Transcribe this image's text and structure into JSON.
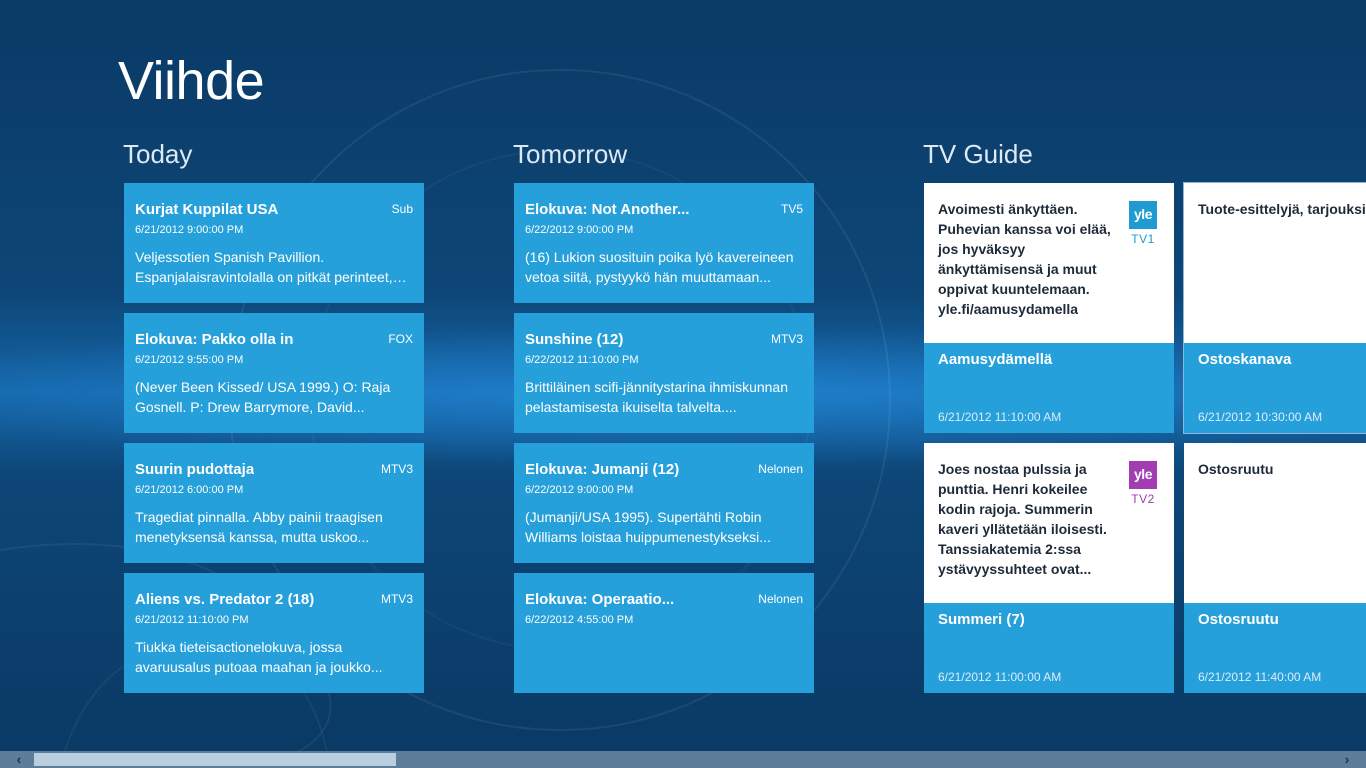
{
  "app": {
    "title": "Viihde"
  },
  "groups": {
    "today": {
      "title": "Today",
      "items": [
        {
          "title": "Kurjat Kuppilat USA",
          "channel": "Sub",
          "date": "6/21/2012 9:00:00 PM",
          "desc": "Veljessotien Spanish Pavillion. Espanjalaisravintolalla on pitkät perinteet, mutta..."
        },
        {
          "title": "Elokuva: Pakko olla in",
          "channel": "FOX",
          "date": "6/21/2012 9:55:00 PM",
          "desc": "(Never Been Kissed/ USA 1999.) O: Raja Gosnell. P: Drew Barrymore, David..."
        },
        {
          "title": "Suurin pudottaja",
          "channel": "MTV3",
          "date": "6/21/2012 6:00:00 PM",
          "desc": "Tragediat pinnalla. Abby painii traagisen menetyksensä kanssa, mutta uskoo..."
        },
        {
          "title": "Aliens vs. Predator 2 (18)",
          "channel": "MTV3",
          "date": "6/21/2012 11:10:00 PM",
          "desc": "Tiukka tieteisactionelokuva, jossa avaruusalus putoaa maahan ja joukko..."
        }
      ]
    },
    "tomorrow": {
      "title": "Tomorrow",
      "items": [
        {
          "title": "Elokuva: Not Another...",
          "channel": "TV5",
          "date": "6/22/2012 9:00:00 PM",
          "desc": "(16) Lukion suosituin poika lyö kavereineen vetoa siitä, pystyykö hän muuttamaan..."
        },
        {
          "title": "Sunshine (12)",
          "channel": "MTV3",
          "date": "6/22/2012 11:10:00 PM",
          "desc": "Brittiläinen scifi-jännitystarina ihmiskunnan pelastamisesta ikuiselta talvelta...."
        },
        {
          "title": "Elokuva: Jumanji (12)",
          "channel": "Nelonen",
          "date": "6/22/2012 9:00:00 PM",
          "desc": "(Jumanji/USA 1995). Supertähti Robin Williams loistaa huippumenestykseksi..."
        },
        {
          "title": "Elokuva: Operaatio...",
          "channel": "Nelonen",
          "date": "6/22/2012 4:55:00 PM",
          "desc": ""
        }
      ]
    },
    "tvguide": {
      "title": "TV Guide",
      "items": [
        {
          "desc": "Avoimesti änkyttäen. Puhevian kanssa voi elää, jos hyväksyy änkyttämisensä ja muut oppivat kuuntelemaan. yle.fi/aamusydamella",
          "show": "Aamusydämellä",
          "time": "6/21/2012 11:10:00 AM",
          "logo_text": "yle",
          "logo_sub": "TV1",
          "logo_color": "#1f9bd1"
        },
        {
          "desc": "Tuote-esittelyjä, tarjouksia",
          "show": "Ostoskanava",
          "time": "6/21/2012 10:30:00 AM",
          "logo_text": "",
          "logo_sub": "",
          "logo_color": ""
        },
        {
          "desc": "Joes nostaa pulssia ja punttia. Henri kokeilee kodin rajoja. Summerin kaveri yllätetään iloisesti. Tanssiakatemia 2:ssa ystävyyssuhteet ovat...",
          "show": "Summeri (7)",
          "time": "6/21/2012 11:00:00 AM",
          "logo_text": "yle",
          "logo_sub": "TV2",
          "logo_color": "#a23db1"
        },
        {
          "desc": "Ostosruutu",
          "show": "Ostosruutu",
          "time": "6/21/2012 11:40:00 AM",
          "logo_text": "",
          "logo_sub": "",
          "logo_color": ""
        }
      ]
    }
  },
  "scrollbar": {
    "left_arrow": "‹",
    "right_arrow": "›"
  },
  "colors": {
    "tile": "#26a0da",
    "background": "#0d4677"
  }
}
